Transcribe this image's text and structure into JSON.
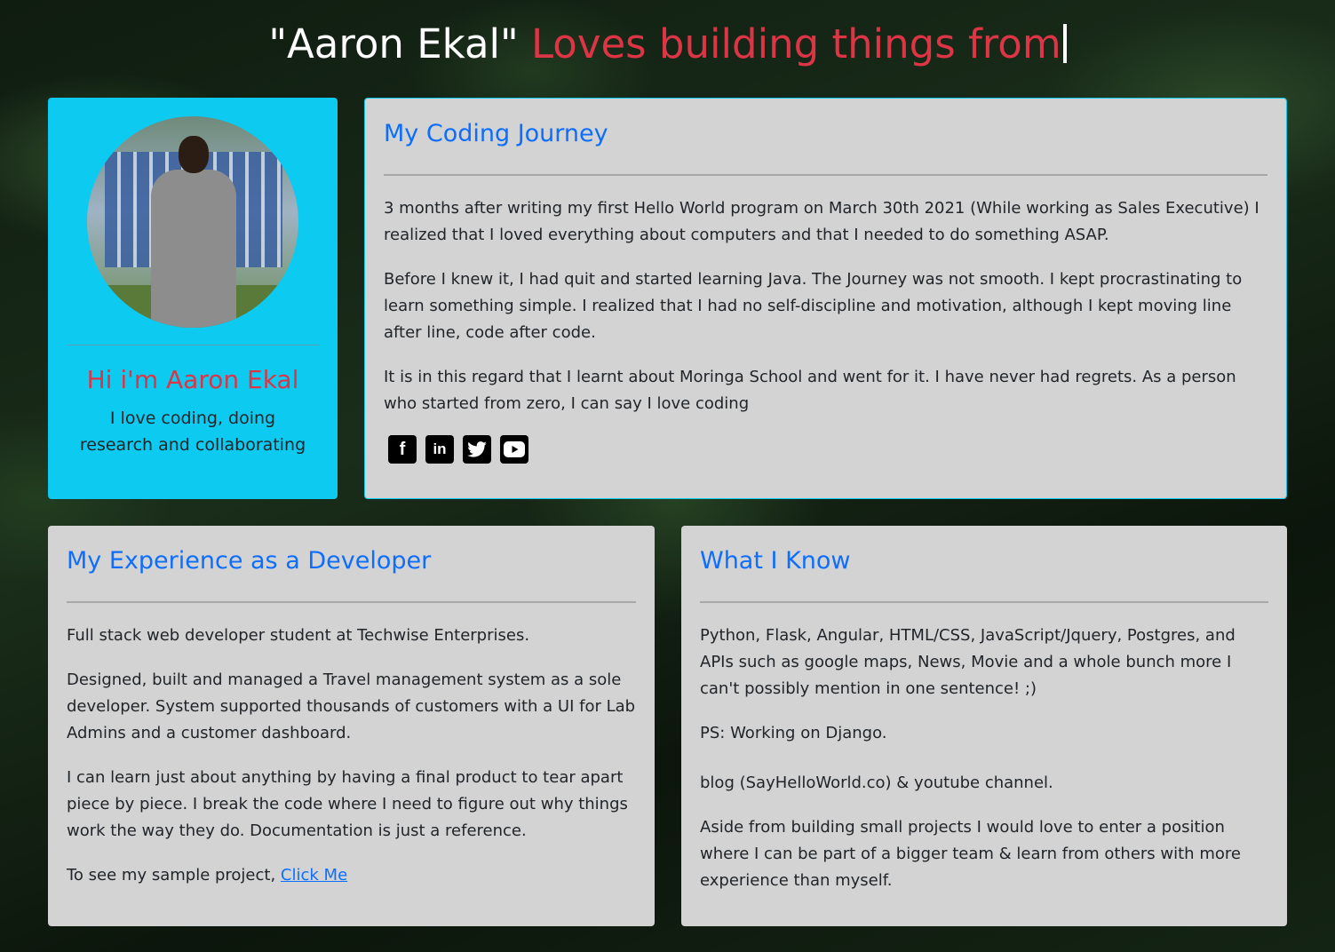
{
  "header": {
    "name": "\"Aaron Ekal\"",
    "typed_text": "Loves building things from"
  },
  "profile": {
    "greeting": "Hi i'm Aaron Ekal",
    "tagline": "I love coding, doing research and collaborating"
  },
  "journey": {
    "title": "My Coding Journey",
    "paragraphs": [
      "3 months after writing my first Hello World program on March 30th 2021 (While working as Sales Executive) I realized that I loved everything about computers and that I needed to do something ASAP.",
      "Before I knew it, I had quit and started learning Java. The Journey was not smooth. I kept procrastinating to learn something simple. I realized that I had no self-discipline and motivation, although I kept moving line after line, code after code.",
      "It is in this regard that I learnt about Moringa School and went for it. I have never had regrets. As a person who started from zero, I can say I love coding"
    ],
    "social_icons": [
      "facebook-icon",
      "linkedin-icon",
      "twitter-icon",
      "youtube-icon"
    ]
  },
  "experience": {
    "title": "My Experience as a Developer",
    "paragraphs": [
      "Full stack web developer student at Techwise Enterprises.",
      "Designed, built and managed a Travel management system as a sole developer. System supported thousands of customers with a UI for Lab Admins and a customer dashboard.",
      "I can learn just about anything by having a final product to tear apart piece by piece. I break the code where I need to figure out why things work the way they do. Documentation is just a reference."
    ],
    "sample_text": "To see my sample project, ",
    "sample_link": "Click Me"
  },
  "know": {
    "title": "What I Know",
    "paragraphs": [
      "Python, Flask, Angular, HTML/CSS, JavaScript/Jquery, Postgres, and APIs such as google maps, News, Movie and a whole bunch more I can't possibly mention in one sentence! ;)",
      "PS: Working on Django.",
      "blog (SayHelloWorld.co) & youtube channel.",
      "Aside from building small projects I would love to enter a position where I can be part of a bigger team & learn from others with more experience than myself."
    ]
  },
  "colors": {
    "accent_red": "#dc3545",
    "accent_blue": "#0d6efd",
    "profile_bg": "#0dcaf0",
    "card_bg": "#d3d3d3"
  }
}
